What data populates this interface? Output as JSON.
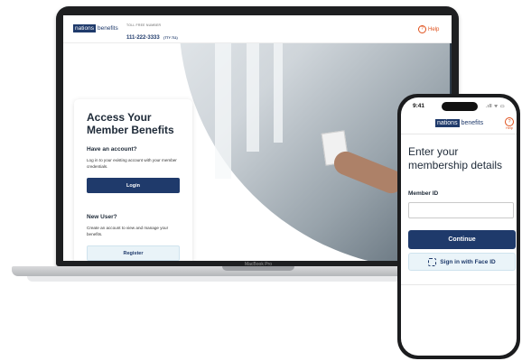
{
  "laptop": {
    "brand": "MacBook Pro",
    "header": {
      "logo_box": "nations",
      "logo_word": "benefits",
      "toll_free_label": "TOLL FREE NUMBER",
      "toll_free_number": "111-222-3333",
      "tty": "(TTY 711)",
      "help": "Help"
    },
    "card": {
      "title": "Access Your Member Benefits",
      "have_account_heading": "Have an account?",
      "have_account_text": "Log in to your existing account with your member credentials.",
      "login_button": "Login",
      "new_user_heading": "New User?",
      "new_user_text": "Create an account to view and manage your benefits.",
      "register_button": "Register"
    }
  },
  "phone": {
    "time": "9:41",
    "status_icons": ".ıll ᯤ ▭",
    "logo_box": "nations",
    "logo_word": "benefits",
    "help_icon": "?",
    "help": "Help",
    "title": "Enter your membership details",
    "member_id_label": "Member ID",
    "member_id_value": "",
    "continue_button": "Continue",
    "faceid_button": "Sign in with Face ID"
  },
  "colors": {
    "brand_navy": "#1f3a6b",
    "help_orange": "#e0501b",
    "secondary_button_bg": "#e9f3f8"
  }
}
